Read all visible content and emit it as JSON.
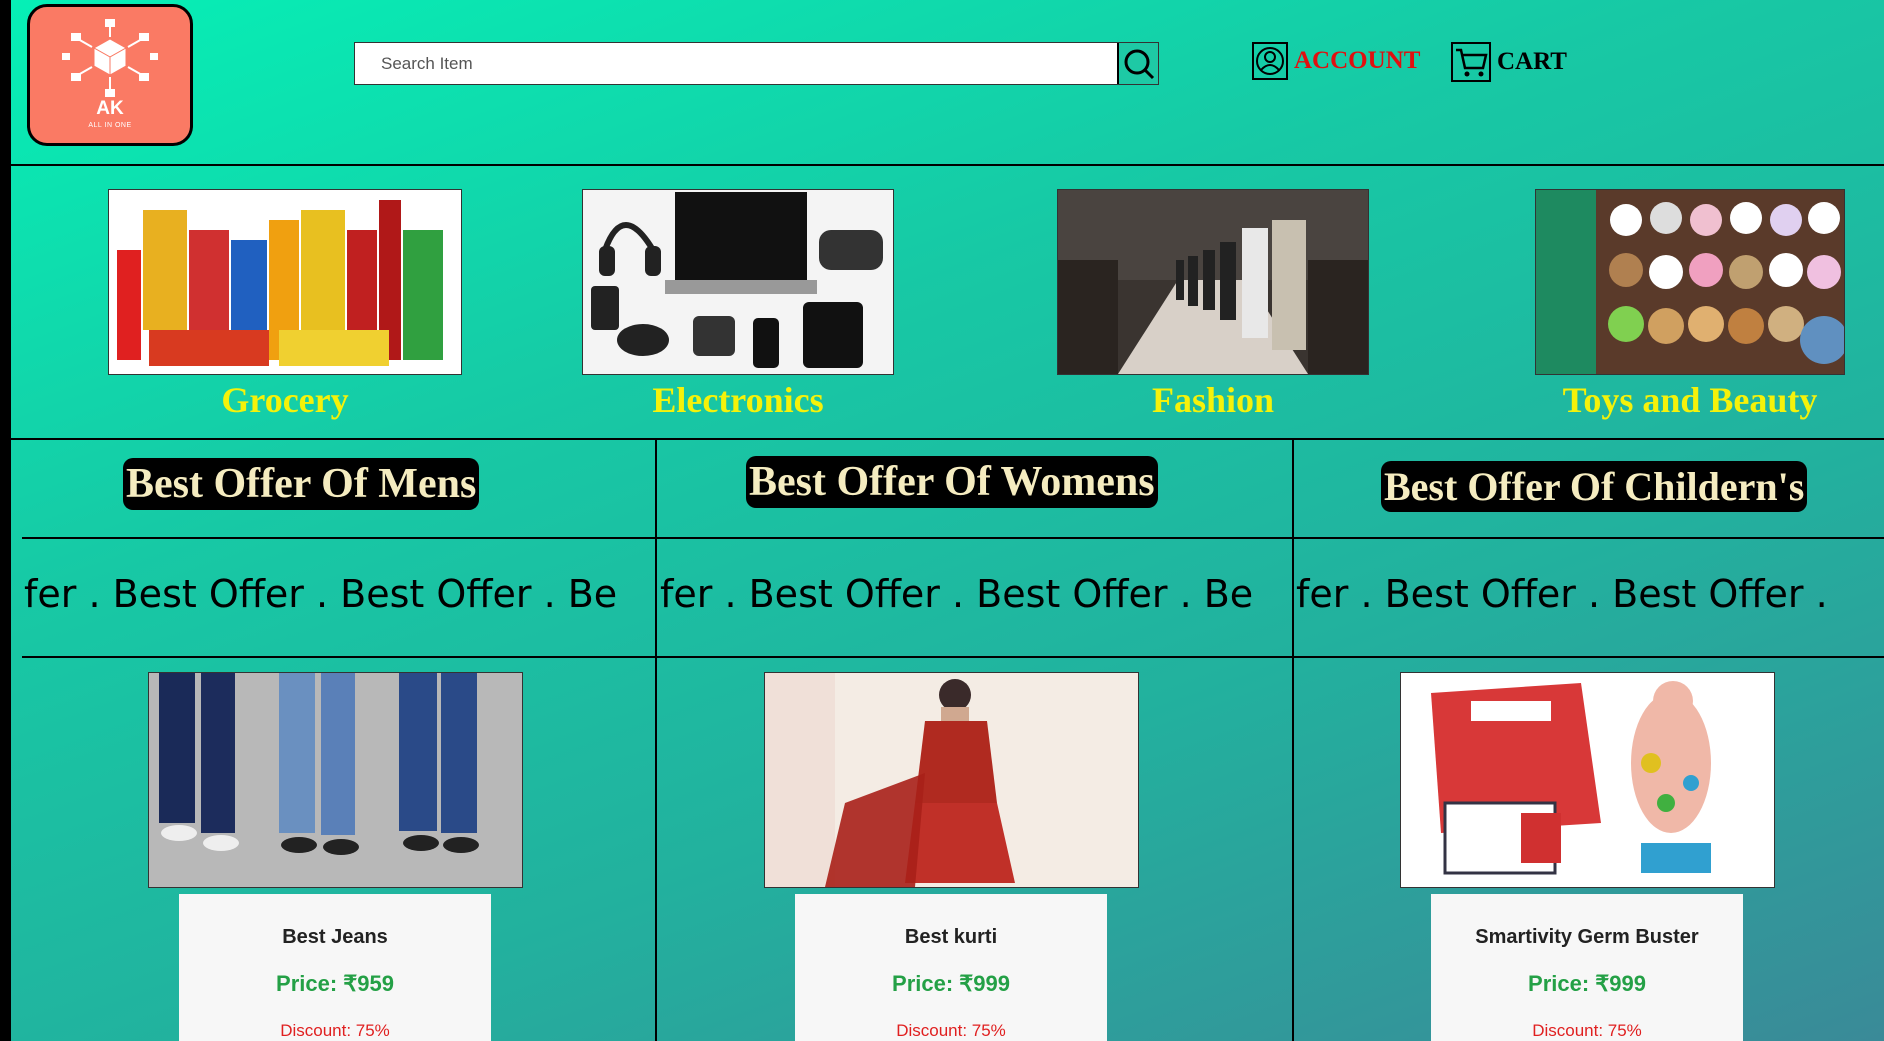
{
  "header": {
    "logo": {
      "brand": "AK",
      "tagline": "ALL IN ONE"
    },
    "search": {
      "placeholder": "Search Item"
    },
    "account_label": "ACCOUNT",
    "cart_label": "CART"
  },
  "categories": [
    {
      "name": "Grocery"
    },
    {
      "name": "Electronics"
    },
    {
      "name": "Fashion"
    },
    {
      "name": "Toys and Beauty"
    }
  ],
  "offers": [
    {
      "title": "Best Offer Of Mens",
      "marquee": "fer .  Best Offer .  Best Offer .  Be",
      "product": {
        "name": "Best Jeans",
        "price": "Price: ₹959",
        "discount": "Discount: 75%"
      }
    },
    {
      "title": "Best Offer Of Womens",
      "marquee": "fer .  Best Offer .  Best Offer .  Be",
      "product": {
        "name": "Best kurti",
        "price": "Price: ₹999",
        "discount": "Discount: 75%"
      }
    },
    {
      "title": "Best Offer Of Childern's",
      "marquee": "fer .  Best Offer .  Best Offer .",
      "product": {
        "name": "Smartivity Germ Buster",
        "price": "Price: ₹999",
        "discount": "Discount: 75%"
      }
    }
  ],
  "colors": {
    "accent_logo": "#fa7a64",
    "category_text": "#f5f20a",
    "account_text": "#e01010",
    "price_text": "#24a046",
    "discount_text": "#e02020"
  }
}
